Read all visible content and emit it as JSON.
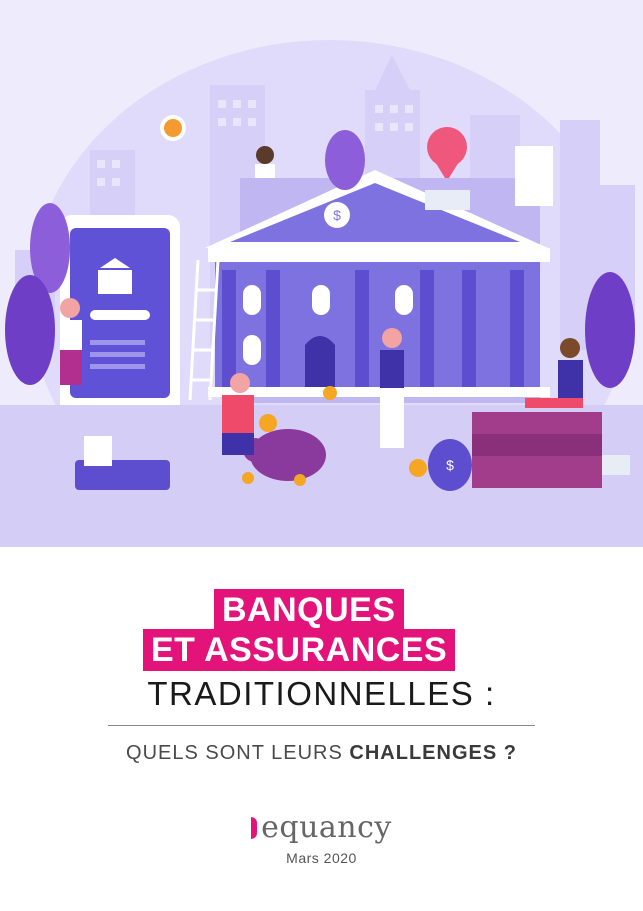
{
  "cover": {
    "title_line1": "BANQUES",
    "title_line2": "ET ASSURANCES",
    "title_line3": "TRADITIONNELLES :",
    "subtitle_prefix": "QUELS SONT LEURS ",
    "subtitle_bold": "CHALLENGES ?",
    "brand": "equancy",
    "date": "Mars 2020"
  },
  "colors": {
    "accent": "#e3137a",
    "illustration_bg": "#cbc2f3",
    "purple_dark": "#5d4ed0"
  }
}
